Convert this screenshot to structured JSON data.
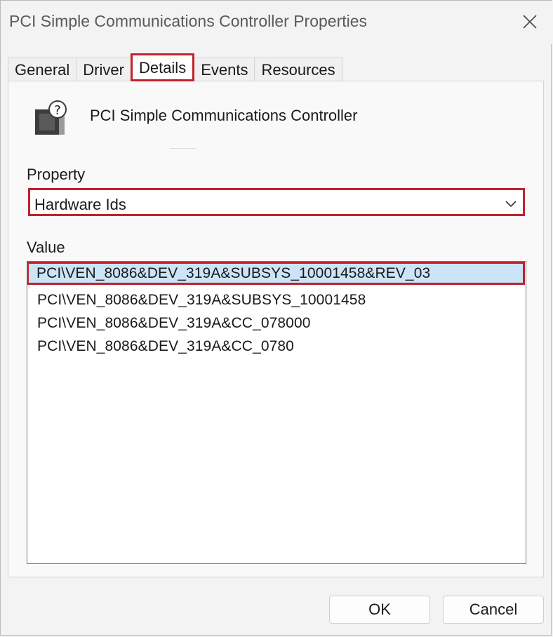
{
  "window": {
    "title": "PCI Simple Communications Controller Properties"
  },
  "tabs": [
    {
      "label": "General",
      "active": false
    },
    {
      "label": "Driver",
      "active": false
    },
    {
      "label": "Details",
      "active": true
    },
    {
      "label": "Events",
      "active": false
    },
    {
      "label": "Resources",
      "active": false
    }
  ],
  "device": {
    "name": "PCI Simple Communications Controller",
    "icon": "unknown-device-icon"
  },
  "property": {
    "label": "Property",
    "selected": "Hardware Ids"
  },
  "value": {
    "label": "Value",
    "items": [
      "PCI\\VEN_8086&DEV_319A&SUBSYS_10001458&REV_03",
      "PCI\\VEN_8086&DEV_319A&SUBSYS_10001458",
      "PCI\\VEN_8086&DEV_319A&CC_078000",
      "PCI\\VEN_8086&DEV_319A&CC_0780"
    ],
    "selected_index": 0
  },
  "buttons": {
    "ok": "OK",
    "cancel": "Cancel"
  },
  "colors": {
    "highlight_border": "#c0222b",
    "selection_fill": "#cce4f7"
  }
}
